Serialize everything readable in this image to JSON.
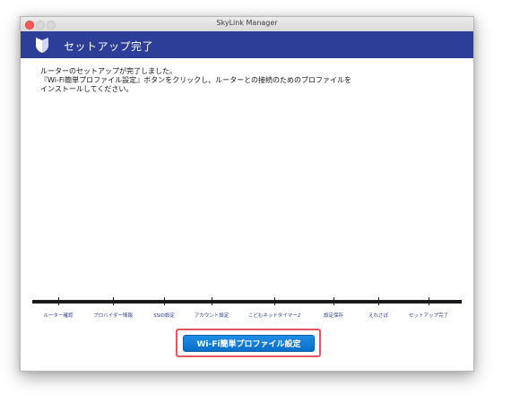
{
  "window": {
    "title": "SkyLink Manager"
  },
  "header": {
    "title": "セットアップ完了",
    "background_color": "#2c3e98",
    "logo_icon": "shield-icon"
  },
  "message": {
    "lines": [
      "ルーターのセットアップが完了しました。",
      "『Wi-Fi簡単プロファイル設定』ボタンをクリックし、ルーターとの接続のためのプロファイルを",
      "インストールしてください。"
    ]
  },
  "steps": [
    {
      "label": "ルーター確認"
    },
    {
      "label": "プロバイダー情報"
    },
    {
      "label": "SSID設定"
    },
    {
      "label": "アカウント設定"
    },
    {
      "label": "こどもネットタイマー2"
    },
    {
      "label": "設定保存"
    },
    {
      "label": "えれさぽ"
    },
    {
      "label": "セットアップ完了"
    }
  ],
  "action": {
    "button_label": "Wi-Fi簡単プロファイル設定",
    "button_color": "#0a6fc9",
    "highlight_color": "#e8555d"
  }
}
